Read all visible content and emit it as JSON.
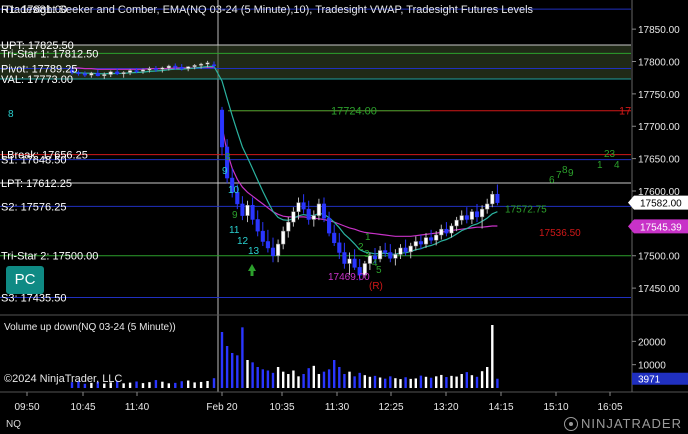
{
  "header": {
    "title": "Tradesight Seeker and Comber, EMA(NQ 03-24 (5 Minute),10), Tradesight VWAP, Tradesight Futures Levels"
  },
  "volume_panel": {
    "title": "Volume up down(NQ 03-24 (5 Minute))",
    "current_volume": "3971"
  },
  "copyright": "©2024 NinjaTrader, LLC",
  "instrument_tab": "NQ",
  "brand": "NINJATRADER",
  "pc_button": "PC",
  "colors": {
    "background": "#000000",
    "up_candle": "#ffffff",
    "down_candle": "#2a36ff",
    "ema": "#2bb3a0",
    "vwap": "#c832c8",
    "level_line": "#2030c0",
    "green_text": "#2ca02c",
    "red_line": "#d01818",
    "seeker_cyan": "#2ad0d0"
  },
  "level_labels": [
    {
      "text": "R1: 17881.00",
      "price": 17881.0
    },
    {
      "text": "UPT: 17825.50",
      "price": 17825.5
    },
    {
      "text": "Tri-Star 1: 17812.50",
      "price": 17812.5
    },
    {
      "text": "Pivot: 17789.25",
      "price": 17789.25
    },
    {
      "text": "VAL: 17773.00",
      "price": 17773.0
    },
    {
      "text": "LBreak: 17656.25",
      "price": 17656.25
    },
    {
      "text": "S1: 17648.50",
      "price": 17648.5
    },
    {
      "text": "LPT: 17612.25",
      "price": 17612.25
    },
    {
      "text": "S2: 17576.25",
      "price": 17576.25
    },
    {
      "text": "Tri-Star 2: 17500.00",
      "price": 17500.0
    },
    {
      "text": "S3: 17435.50",
      "price": 17435.5
    }
  ],
  "annotations": [
    {
      "text": "17724.00",
      "price": 17724.0
    },
    {
      "text": "17469.00",
      "price": 17469.0
    },
    {
      "text": "17572.75",
      "price": 17572.75
    },
    {
      "text": "17536.50",
      "price": 17536.5
    },
    {
      "text": "(R)",
      "price": 17425.0
    }
  ],
  "seeker_numbers": [
    "8",
    "9",
    "10",
    "11",
    "12",
    "13",
    "8",
    "9",
    "1",
    "2",
    "3",
    "4",
    "5",
    "6",
    "7",
    "8",
    "9",
    "23",
    "1",
    "4"
  ],
  "price_markers": {
    "last_price": "17582.00",
    "vwap_price": "17545.39"
  },
  "chart_data": {
    "type": "candlestick",
    "title": "Tradesight Seeker and Comber, EMA(NQ 03-24 (5 Minute),10), Tradesight VWAP, Tradesight Futures Levels",
    "y_range": [
      17410,
      17895
    ],
    "y_ticks": [
      17450,
      17500,
      17550,
      17600,
      17650,
      17700,
      17750,
      17800,
      17850
    ],
    "y_tick_labels": [
      "17450.00",
      "17500.00",
      "17550.00",
      "17600.00",
      "17650.00",
      "17700.00",
      "17750.00",
      "17800.00",
      "17850.00"
    ],
    "x_tick_labels": [
      "09:50",
      "10:45",
      "11:40",
      "Feb 20",
      "10:35",
      "11:30",
      "12:25",
      "13:20",
      "14:15",
      "15:10",
      "16:05"
    ],
    "candles": [
      [
        17787,
        17792,
        17780,
        17783
      ],
      [
        17783,
        17786,
        17778,
        17781
      ],
      [
        17781,
        17785,
        17776,
        17779
      ],
      [
        17779,
        17784,
        17775,
        17782
      ],
      [
        17782,
        17787,
        17777,
        17778
      ],
      [
        17778,
        17783,
        17773,
        17780
      ],
      [
        17780,
        17786,
        17776,
        17784
      ],
      [
        17784,
        17789,
        17779,
        17781
      ],
      [
        17781,
        17785,
        17775,
        17783
      ],
      [
        17783,
        17788,
        17779,
        17786
      ],
      [
        17786,
        17790,
        17782,
        17785
      ],
      [
        17785,
        17789,
        17781,
        17787
      ],
      [
        17787,
        17792,
        17783,
        17789
      ],
      [
        17789,
        17793,
        17784,
        17788
      ],
      [
        17788,
        17792,
        17783,
        17790
      ],
      [
        17790,
        17795,
        17786,
        17793
      ],
      [
        17793,
        17797,
        17787,
        17791
      ],
      [
        17791,
        17796,
        17786,
        17789
      ],
      [
        17789,
        17793,
        17785,
        17792
      ],
      [
        17792,
        17796,
        17788,
        17794
      ],
      [
        17794,
        17798,
        17789,
        17796
      ],
      [
        17796,
        17801,
        17791,
        17798
      ],
      [
        17795,
        17800,
        17790,
        17794
      ],
      [
        17725,
        17730,
        17655,
        17668
      ],
      [
        17668,
        17680,
        17612,
        17620
      ],
      [
        17620,
        17635,
        17590,
        17598
      ],
      [
        17598,
        17610,
        17572,
        17580
      ],
      [
        17580,
        17592,
        17555,
        17562
      ],
      [
        17562,
        17585,
        17552,
        17578
      ],
      [
        17578,
        17590,
        17548,
        17556
      ],
      [
        17556,
        17570,
        17530,
        17538
      ],
      [
        17538,
        17552,
        17515,
        17522
      ],
      [
        17522,
        17540,
        17505,
        17512
      ],
      [
        17512,
        17528,
        17490,
        17500
      ],
      [
        17500,
        17525,
        17490,
        17518
      ],
      [
        17518,
        17545,
        17510,
        17538
      ],
      [
        17538,
        17560,
        17528,
        17552
      ],
      [
        17552,
        17575,
        17545,
        17568
      ],
      [
        17568,
        17590,
        17556,
        17582
      ],
      [
        17582,
        17595,
        17565,
        17572
      ],
      [
        17572,
        17585,
        17548,
        17556
      ],
      [
        17556,
        17570,
        17545,
        17562
      ],
      [
        17562,
        17588,
        17555,
        17580
      ],
      [
        17580,
        17590,
        17552,
        17558
      ],
      [
        17558,
        17568,
        17530,
        17535
      ],
      [
        17535,
        17548,
        17515,
        17520
      ],
      [
        17520,
        17535,
        17495,
        17505
      ],
      [
        17505,
        17520,
        17480,
        17488
      ],
      [
        17488,
        17505,
        17470,
        17495
      ],
      [
        17495,
        17510,
        17478,
        17482
      ],
      [
        17482,
        17495,
        17462,
        17470
      ],
      [
        17470,
        17492,
        17466,
        17488
      ],
      [
        17488,
        17505,
        17478,
        17500
      ],
      [
        17500,
        17512,
        17488,
        17495
      ],
      [
        17495,
        17515,
        17490,
        17508
      ],
      [
        17508,
        17520,
        17498,
        17505
      ],
      [
        17505,
        17518,
        17490,
        17496
      ],
      [
        17496,
        17510,
        17485,
        17502
      ],
      [
        17502,
        17518,
        17495,
        17512
      ],
      [
        17512,
        17525,
        17500,
        17506
      ],
      [
        17506,
        17520,
        17496,
        17515
      ],
      [
        17515,
        17530,
        17508,
        17522
      ],
      [
        17522,
        17532,
        17510,
        17518
      ],
      [
        17518,
        17535,
        17512,
        17528
      ],
      [
        17528,
        17540,
        17518,
        17524
      ],
      [
        17524,
        17538,
        17516,
        17532
      ],
      [
        17532,
        17548,
        17525,
        17541
      ],
      [
        17541,
        17552,
        17530,
        17535
      ],
      [
        17535,
        17550,
        17528,
        17546
      ],
      [
        17546,
        17560,
        17538,
        17555
      ],
      [
        17555,
        17570,
        17548,
        17562
      ],
      [
        17562,
        17575,
        17550,
        17556
      ],
      [
        17556,
        17572,
        17549,
        17568
      ],
      [
        17568,
        17580,
        17552,
        17560
      ],
      [
        17560,
        17578,
        17542,
        17572
      ],
      [
        17572,
        17588,
        17565,
        17580
      ],
      [
        17580,
        17600,
        17575,
        17595
      ],
      [
        17595,
        17610,
        17578,
        17582
      ]
    ],
    "ema_period": 10,
    "vwap": [
      17790,
      17790,
      17789,
      17789,
      17788,
      17788,
      17788,
      17788,
      17788,
      17788,
      17788,
      17788,
      17789,
      17789,
      17789,
      17789,
      17790,
      17790,
      17790,
      17790,
      17791,
      17791,
      17791,
      17700,
      17660,
      17635,
      17618,
      17606,
      17598,
      17592,
      17586,
      17580,
      17574,
      17568,
      17564,
      17561,
      17560,
      17560,
      17560,
      17560,
      17559,
      17558,
      17557,
      17556,
      17554,
      17552,
      17549,
      17546,
      17543,
      17541,
      17538,
      17536,
      17535,
      17534,
      17533,
      17532,
      17531,
      17530,
      17530,
      17530,
      17530,
      17531,
      17532,
      17533,
      17534,
      17535,
      17536,
      17538,
      17539,
      17540,
      17541,
      17542,
      17543,
      17544,
      17544,
      17545,
      17546,
      17546,
      17545
    ],
    "volume": {
      "y_range": [
        0,
        30000
      ],
      "y_ticks": [
        10000,
        20000
      ],
      "y_tick_labels": [
        "10000",
        "20000"
      ],
      "values": [
        2500,
        3000,
        1800,
        2200,
        2600,
        1900,
        2400,
        3100,
        2000,
        2300,
        2800,
        2100,
        2500,
        3400,
        2700,
        2000,
        2200,
        2900,
        3200,
        2400,
        2600,
        3000,
        4200,
        24000,
        18000,
        15000,
        14000,
        26000,
        12000,
        11000,
        9000,
        8000,
        7500,
        6500,
        9000,
        7000,
        6000,
        7500,
        5000,
        6000,
        8500,
        9500,
        6000,
        7000,
        8000,
        12000,
        9000,
        6000,
        7000,
        5000,
        6500,
        5500,
        4800,
        5200,
        4500,
        4000,
        5000,
        4200,
        3800,
        4600,
        3900,
        4100,
        5300,
        4800,
        4400,
        5000,
        5600,
        4700,
        5200,
        4900,
        6000,
        6800,
        5500,
        4800,
        7200,
        9000,
        27000,
        3971
      ]
    }
  }
}
